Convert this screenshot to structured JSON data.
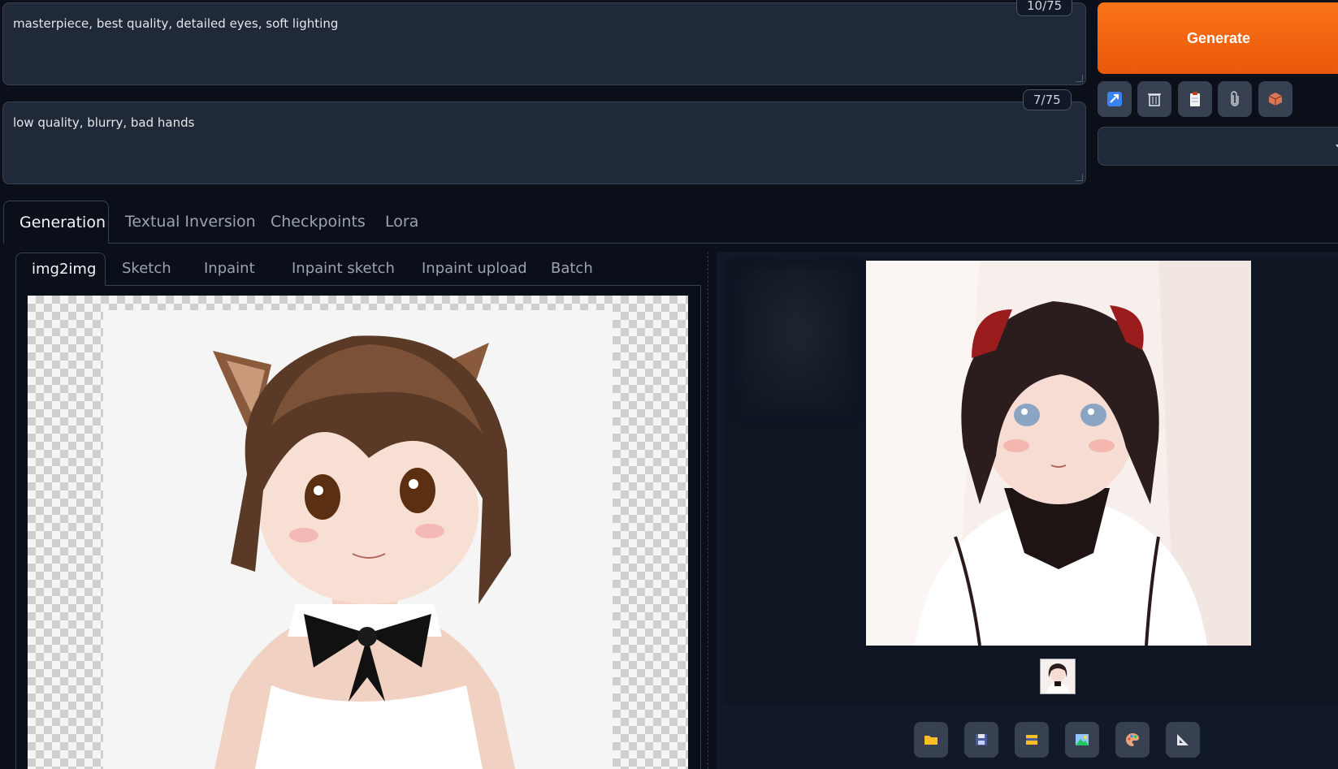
{
  "prompt": {
    "positive_text": "masterpiece, best quality, detailed eyes, soft lighting",
    "positive_counter": "10/75",
    "negative_text": "low quality, blurry, bad hands",
    "negative_counter": "7/75"
  },
  "actions": {
    "generate_label": "Generate",
    "tool_icons": [
      "arrow-checkbox-icon",
      "trash-icon",
      "clipboard-icon",
      "paperclip-icon",
      "box-icon"
    ],
    "style_value": ""
  },
  "main_tabs": [
    "Generation",
    "Textual Inversion",
    "Checkpoints",
    "Lora"
  ],
  "input_tabs": [
    "img2img",
    "Sketch",
    "Inpaint",
    "Inpaint sketch",
    "Inpaint upload",
    "Batch"
  ],
  "output": {
    "button_icons": [
      "folder-icon",
      "save-icon",
      "zip-icon",
      "image-icon",
      "palette-icon",
      "triangle-ruler-icon"
    ]
  },
  "colors": {
    "background": "#0b0f19",
    "panel": "#1f2937",
    "accent": "#f97316"
  }
}
